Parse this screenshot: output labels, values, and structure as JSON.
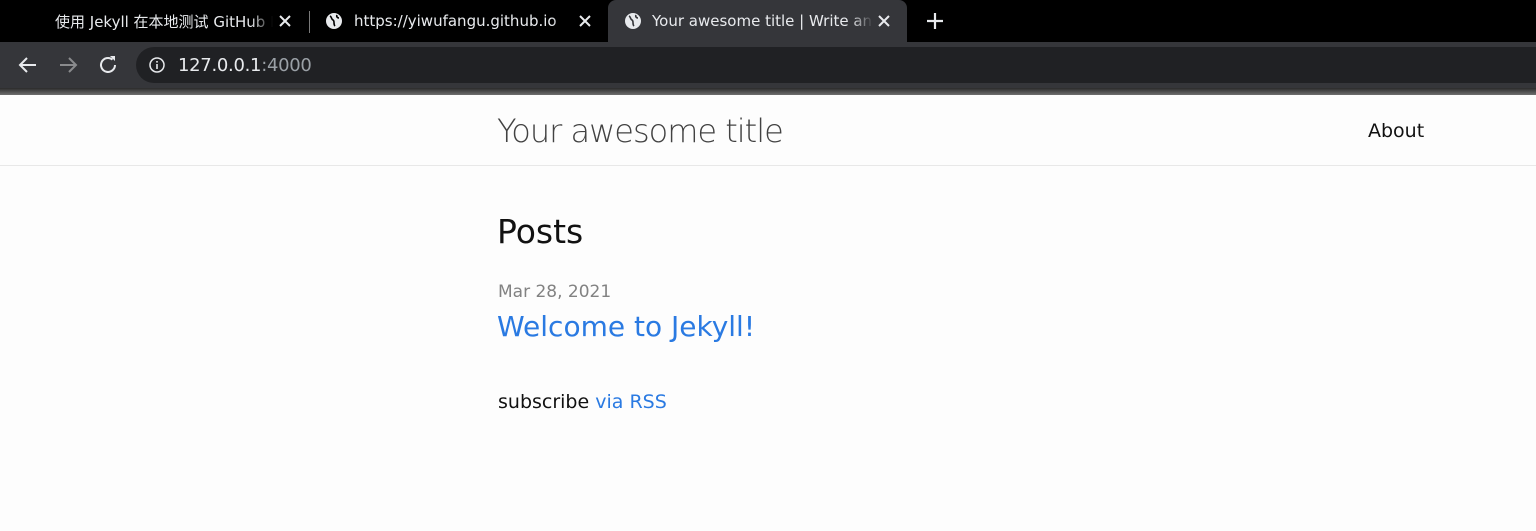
{
  "browser": {
    "tabs": [
      {
        "title": "使用 Jekyll 在本地测试 GitHub Pages",
        "active": false
      },
      {
        "title": "https://yiwufangu.github.io",
        "active": false
      },
      {
        "title": "Your awesome title | Write an awesome description",
        "active": true
      }
    ],
    "url_host": "127.0.0.1",
    "url_port": ":4000"
  },
  "site": {
    "title": "Your awesome title",
    "nav": {
      "about": "About"
    }
  },
  "main": {
    "heading": "Posts",
    "posts": [
      {
        "date": "Mar 28, 2021",
        "title": "Welcome to Jekyll!"
      }
    ],
    "rss": {
      "text": "subscribe",
      "link": "via RSS"
    }
  },
  "colors": {
    "link": "#2a7ae2",
    "meta": "#828282",
    "chrome": "#35363a"
  }
}
